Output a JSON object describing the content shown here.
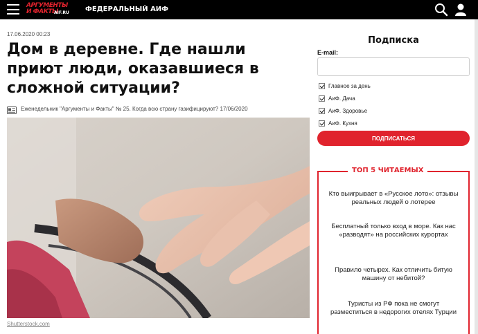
{
  "header": {
    "logo_line1": "АРГУМЕНТЫ",
    "logo_line2": "И ФАКТЫ",
    "logo_domain": "AIF.RU",
    "section": "ФЕДЕРАЛЬНЫЙ АИФ",
    "icons": [
      "menu-icon",
      "search-icon",
      "user-icon"
    ]
  },
  "article": {
    "date": "17.06.2020 00:23",
    "title": "Дом в деревне. Где нашли приют люди, оказавшиеся в сложной ситуации?",
    "issue": "Еженедельник \"Аргументы и Факты\" № 25. Когда всю страну газифицируют? 17/06/2020",
    "photo_credit": "Shutterstock.com"
  },
  "subscription": {
    "title": "Подписка",
    "email_label": "E-mail:",
    "email_value": "",
    "options": [
      {
        "label": "Главное за день",
        "checked": true
      },
      {
        "label": "АиФ. Дача",
        "checked": true
      },
      {
        "label": "АиФ. Здоровье",
        "checked": true
      },
      {
        "label": "АиФ. Кухня",
        "checked": true
      }
    ],
    "button": "ПОДПИСАТЬСЯ"
  },
  "top5": {
    "title": "ТОП 5 ЧИТАЕМЫХ",
    "items": [
      "Кто выигрывает в «Русское лото»: отзывы реальных людей о лотерее",
      "Бесплатный только вход в море. Как нас «разводят» на российских курортах",
      "Правило четырех. Как отличить битую машину от небитой?",
      "Туристы из РФ пока не смогут разместиться в недорогих отелях Турции"
    ]
  },
  "colors": {
    "brand_red": "#e0232d",
    "header_bg": "#000000"
  }
}
